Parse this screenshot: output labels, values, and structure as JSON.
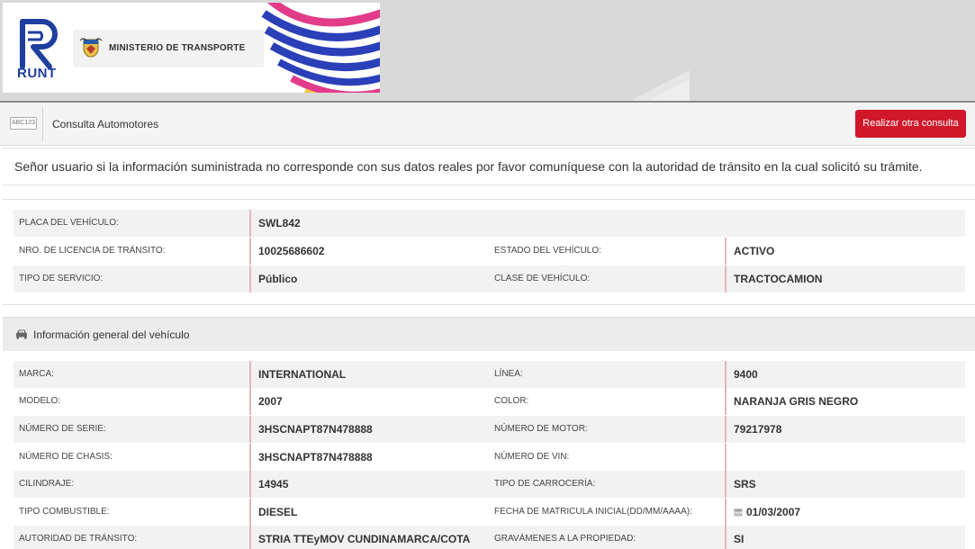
{
  "header": {
    "logo_text": "RUNT",
    "ministry_name": "MINISTERIO DE TRANSPORTE"
  },
  "toolbar": {
    "icon_label": "ABC123",
    "title": "Consulta Automotores",
    "button_label": "Realizar otra consulta"
  },
  "notice": {
    "text": "Señor usuario si la información suministrada no corresponde con sus datos reales por favor comuníquese con la autoridad de tránsito en la cual solicitó su trámite."
  },
  "summary": {
    "placa_label": "PLACA DEL VEHÍCULO:",
    "placa_value": "SWL842",
    "licencia_label": "NRO. DE LICENCIA DE TRÁNSITO:",
    "licencia_value": "10025686602",
    "estado_label": "ESTADO DEL VEHÍCULO:",
    "estado_value": "ACTIVO",
    "servicio_label": "TIPO DE SERVICIO:",
    "servicio_value": "Público",
    "clase_label": "CLASE DE VEHÍCULO:",
    "clase_value": "TRACTOCAMION"
  },
  "general": {
    "section_title": "Información general del vehículo",
    "rows": [
      {
        "l1": "MARCA:",
        "v1": "INTERNATIONAL",
        "l2": "LÍNEA:",
        "v2": "9400"
      },
      {
        "l1": "MODELO:",
        "v1": "2007",
        "l2": "COLOR:",
        "v2": "NARANJA GRIS NEGRO"
      },
      {
        "l1": "NÚMERO DE SERIE:",
        "v1": "3HSCNAPT87N478888",
        "l2": "NÚMERO DE MOTOR:",
        "v2": "79217978"
      },
      {
        "l1": "NÚMERO DE CHASIS:",
        "v1": "3HSCNAPT87N478888",
        "l2": "NÚMERO DE VIN:",
        "v2": ""
      },
      {
        "l1": "CILINDRAJE:",
        "v1": "14945",
        "l2": "TIPO DE CARROCERÍA:",
        "v2": "SRS"
      },
      {
        "l1": "TIPO COMBUSTIBLE:",
        "v1": "DIESEL",
        "l2": "FECHA DE MATRICULA INICIAL(DD/MM/AAAA):",
        "v2": "01/03/2007"
      },
      {
        "l1": "AUTORIDAD DE TRÁNSITO:",
        "v1": "STRIA TTEyMOV CUNDINAMARCA/COTA",
        "l2": "GRAVÁMENES A LA PROPIEDAD:",
        "v2": "SI"
      }
    ]
  },
  "colors": {
    "accent_red": "#d0182a",
    "runt_blue": "#1e3fa0"
  }
}
